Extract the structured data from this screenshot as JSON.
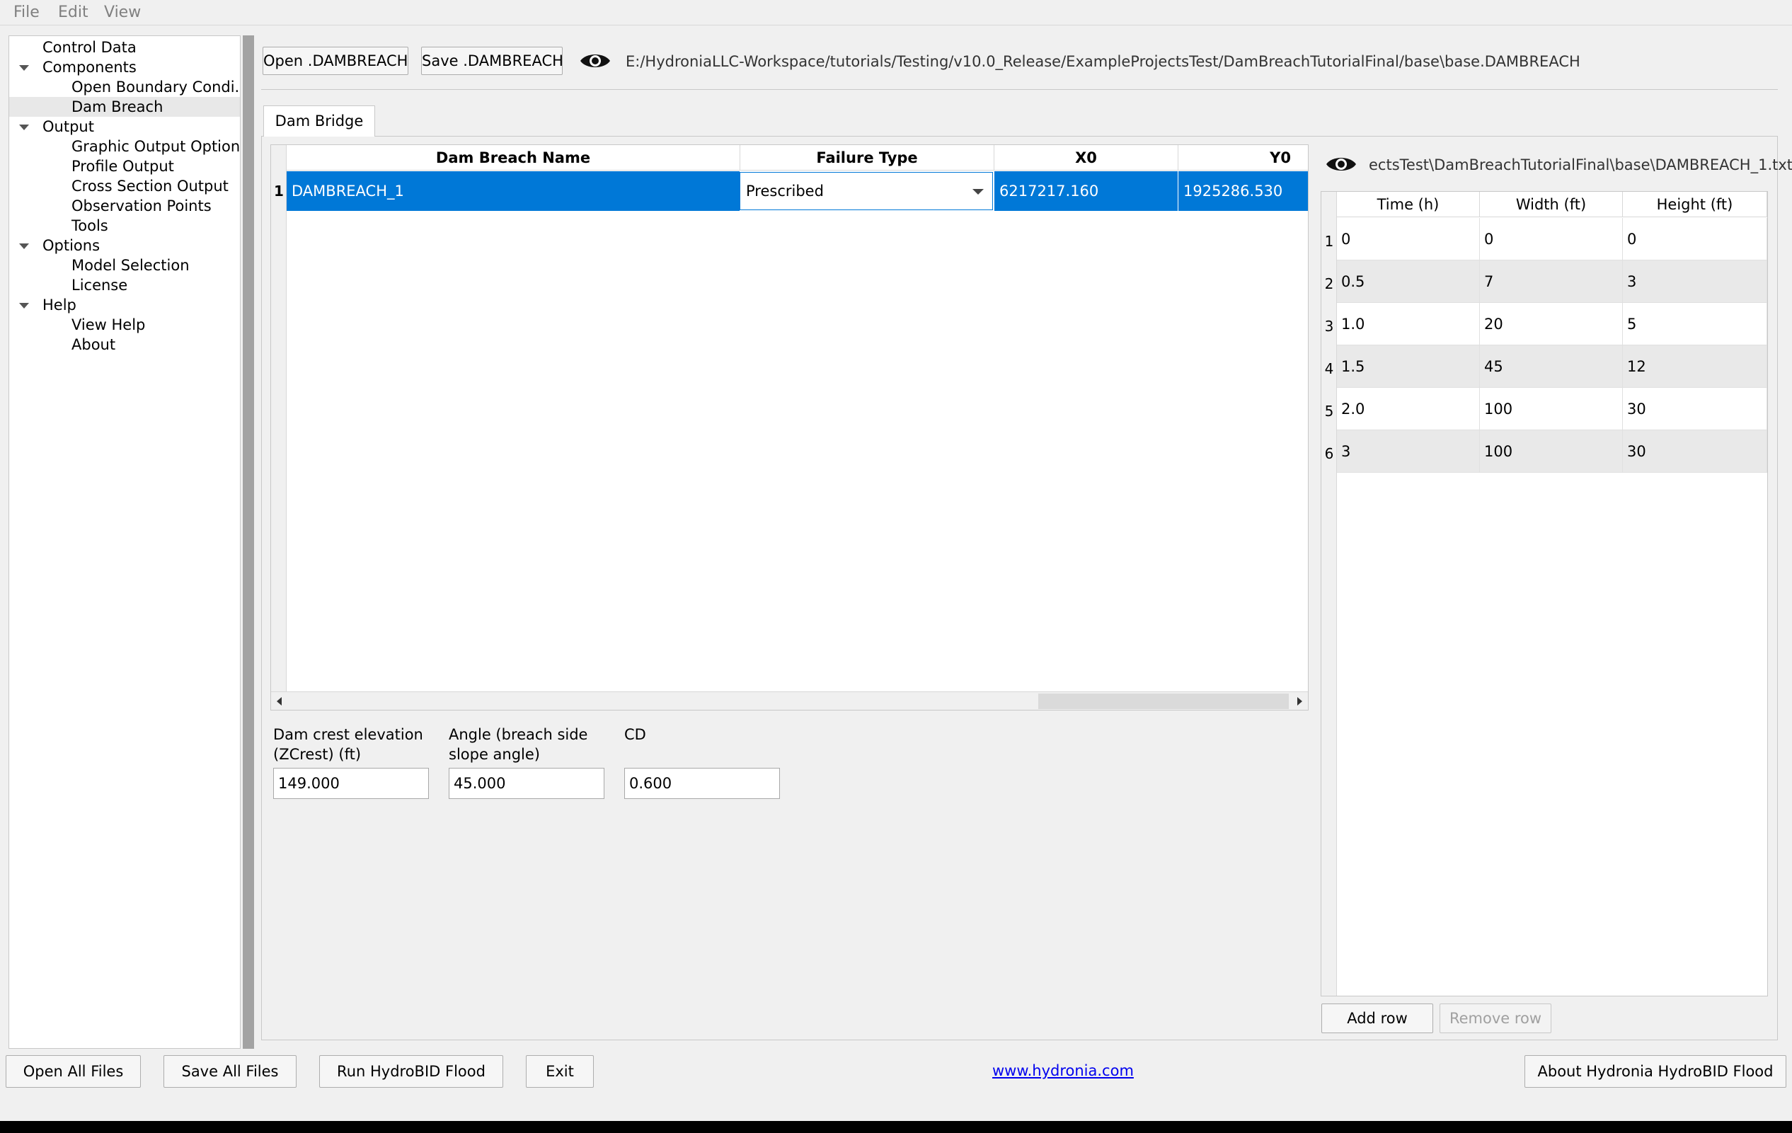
{
  "menu": [
    "File",
    "Edit",
    "View"
  ],
  "sidebar": {
    "items": [
      {
        "label": "Control Data",
        "expandable": false
      },
      {
        "label": "Components",
        "expandable": true
      },
      {
        "label": "Open Boundary Condi...",
        "expandable": false
      },
      {
        "label": "Dam Breach",
        "expandable": false,
        "selected": true
      },
      {
        "label": "Output",
        "expandable": true
      },
      {
        "label": "Graphic Output Options",
        "expandable": false
      },
      {
        "label": "Profile Output",
        "expandable": false
      },
      {
        "label": "Cross Section Output",
        "expandable": false
      },
      {
        "label": "Observation Points",
        "expandable": false
      },
      {
        "label": "Tools",
        "expandable": false
      },
      {
        "label": "Options",
        "expandable": true
      },
      {
        "label": "Model Selection",
        "expandable": false
      },
      {
        "label": "License",
        "expandable": false
      },
      {
        "label": "Help",
        "expandable": true
      },
      {
        "label": "View Help",
        "expandable": false
      },
      {
        "label": "About",
        "expandable": false
      }
    ]
  },
  "toolbar": {
    "open_label": "Open .DAMBREACH",
    "save_label": "Save .DAMBREACH",
    "file_path": "E:/HydroniaLLC-Workspace/tutorials/Testing/v10.0_Release/ExampleProjectsTest/DamBreachTutorialFinal/base\\base.DAMBREACH"
  },
  "tab": {
    "label": "Dam Bridge"
  },
  "main_table": {
    "columns": [
      "Dam Breach Name",
      "Failure Type",
      "X0",
      "Y0"
    ],
    "rows": [
      {
        "num": "1",
        "name": "DAMBREACH_1",
        "failure_type": "Prescribed",
        "x0": "6217217.160",
        "y0": "1925286.530"
      }
    ]
  },
  "params": {
    "zcrest": {
      "label_line1": "Dam crest elevation",
      "label_line2": "(ZCrest) (ft)",
      "value": "149.000"
    },
    "angle": {
      "label_line1": "Angle (breach side",
      "label_line2": "slope angle)",
      "value": "45.000"
    },
    "cd": {
      "label_line1": "CD",
      "label_line2": "",
      "value": "0.600"
    }
  },
  "breach_file": {
    "path": "ectsTest\\DamBreachTutorialFinal\\base\\DAMBREACH_1.txt",
    "columns": [
      "Time (h)",
      "Width (ft)",
      "Height (ft)"
    ],
    "rows": [
      {
        "num": "1",
        "time": "0",
        "width": "0",
        "height": "0"
      },
      {
        "num": "2",
        "time": "0.5",
        "width": "7",
        "height": "3"
      },
      {
        "num": "3",
        "time": "1.0",
        "width": "20",
        "height": "5"
      },
      {
        "num": "4",
        "time": "1.5",
        "width": "45",
        "height": "12"
      },
      {
        "num": "5",
        "time": "2.0",
        "width": "100",
        "height": "30"
      },
      {
        "num": "6",
        "time": "3",
        "width": "100",
        "height": "30"
      }
    ],
    "add_row_label": "Add row",
    "remove_row_label": "Remove row"
  },
  "footer": {
    "open_all": "Open All Files",
    "save_all": "Save All Files",
    "run": "Run HydroBID Flood",
    "exit": "Exit",
    "website": "www.hydronia.com",
    "about": "About Hydronia HydroBID Flood"
  },
  "colors": {
    "selection": "#0078d7",
    "link": "#0000ee"
  }
}
